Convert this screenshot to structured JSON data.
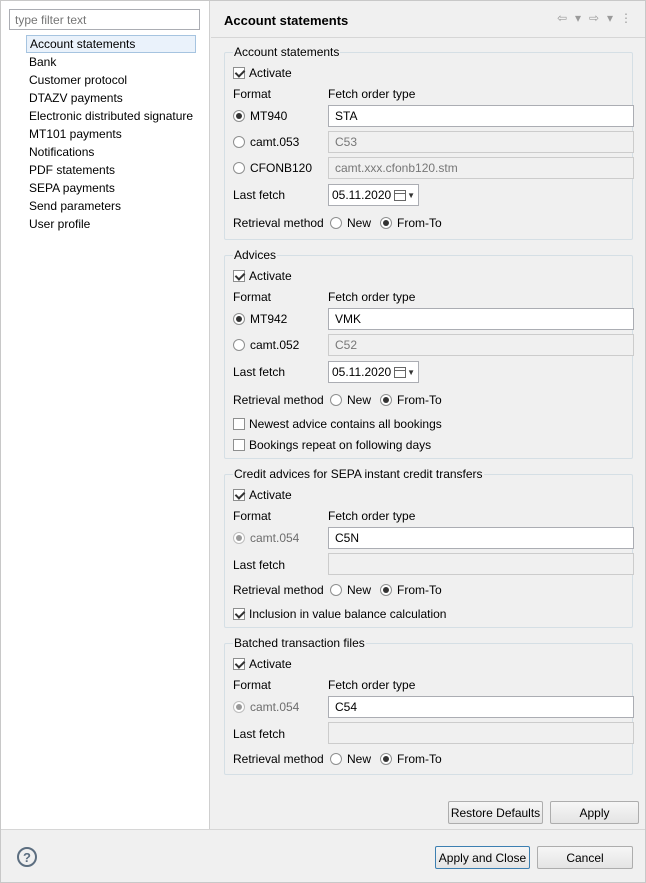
{
  "filter": {
    "placeholder": "type filter text"
  },
  "tree": {
    "items": [
      "Account statements",
      "Bank",
      "Customer protocol",
      "DTAZV payments",
      "Electronic distributed signature",
      "MT101 payments",
      "Notifications",
      "PDF statements",
      "SEPA payments",
      "Send parameters",
      "User profile"
    ],
    "selected": "Account statements"
  },
  "page": {
    "title": "Account statements"
  },
  "nav": {
    "back": "⇦",
    "dropdown": "▾",
    "forward": "⇨",
    "menu": "⋮"
  },
  "labels": {
    "activate": "Activate",
    "format": "Format",
    "fetch_order_type": "Fetch order type",
    "last_fetch": "Last fetch",
    "retrieval_method": "Retrieval method",
    "new": "New",
    "from_to": "From-To"
  },
  "account_statements": {
    "title": "Account statements",
    "activate": true,
    "formats": [
      {
        "name": "MT940",
        "value": "STA",
        "selected": true
      },
      {
        "name": "camt.053",
        "value": "C53",
        "selected": false
      },
      {
        "name": "CFONB120",
        "value": "camt.xxx.cfonb120.stm",
        "selected": false
      }
    ],
    "last_fetch": "05.11.2020",
    "retrieval": "From-To"
  },
  "advices": {
    "title": "Advices",
    "activate": true,
    "formats": [
      {
        "name": "MT942",
        "value": "VMK",
        "selected": true
      },
      {
        "name": "camt.052",
        "value": "C52",
        "selected": false
      }
    ],
    "last_fetch": "05.11.2020",
    "retrieval": "From-To",
    "newest_advice": "Newest advice contains all bookings",
    "bookings_repeat": "Bookings repeat on following days"
  },
  "credit_advices": {
    "title": "Credit advices for SEPA instant credit transfers",
    "activate": true,
    "format": "camt.054",
    "value": "C5N",
    "last_fetch": "",
    "retrieval": "From-To",
    "inclusion": "Inclusion in value balance calculation"
  },
  "batched": {
    "title": "Batched transaction files",
    "activate": true,
    "format": "camt.054",
    "value": "C54",
    "last_fetch": "",
    "retrieval": "From-To"
  },
  "buttons": {
    "restore_defaults": "Restore Defaults",
    "apply": "Apply",
    "apply_and_close": "Apply and Close",
    "cancel": "Cancel"
  },
  "help": {
    "symbol": "?"
  }
}
